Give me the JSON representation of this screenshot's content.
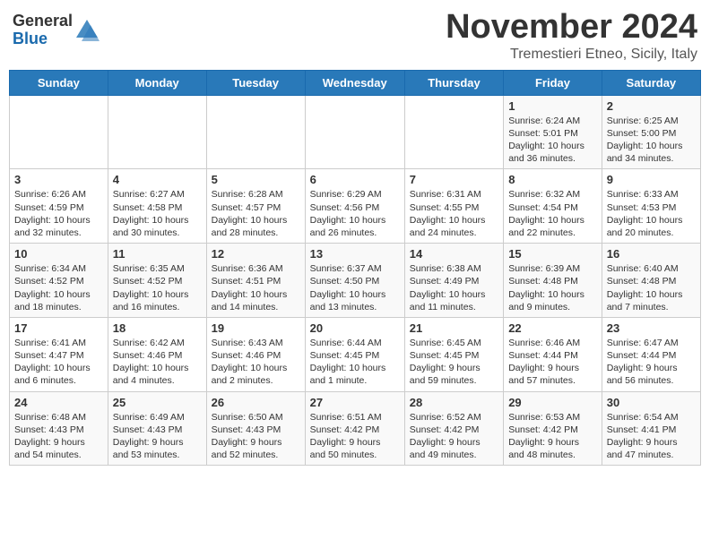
{
  "logo": {
    "general": "General",
    "blue": "Blue"
  },
  "title": "November 2024",
  "location": "Tremestieri Etneo, Sicily, Italy",
  "days_of_week": [
    "Sunday",
    "Monday",
    "Tuesday",
    "Wednesday",
    "Thursday",
    "Friday",
    "Saturday"
  ],
  "weeks": [
    [
      {
        "day": "",
        "content": ""
      },
      {
        "day": "",
        "content": ""
      },
      {
        "day": "",
        "content": ""
      },
      {
        "day": "",
        "content": ""
      },
      {
        "day": "",
        "content": ""
      },
      {
        "day": "1",
        "content": "Sunrise: 6:24 AM\nSunset: 5:01 PM\nDaylight: 10 hours\nand 36 minutes."
      },
      {
        "day": "2",
        "content": "Sunrise: 6:25 AM\nSunset: 5:00 PM\nDaylight: 10 hours\nand 34 minutes."
      }
    ],
    [
      {
        "day": "3",
        "content": "Sunrise: 6:26 AM\nSunset: 4:59 PM\nDaylight: 10 hours\nand 32 minutes."
      },
      {
        "day": "4",
        "content": "Sunrise: 6:27 AM\nSunset: 4:58 PM\nDaylight: 10 hours\nand 30 minutes."
      },
      {
        "day": "5",
        "content": "Sunrise: 6:28 AM\nSunset: 4:57 PM\nDaylight: 10 hours\nand 28 minutes."
      },
      {
        "day": "6",
        "content": "Sunrise: 6:29 AM\nSunset: 4:56 PM\nDaylight: 10 hours\nand 26 minutes."
      },
      {
        "day": "7",
        "content": "Sunrise: 6:31 AM\nSunset: 4:55 PM\nDaylight: 10 hours\nand 24 minutes."
      },
      {
        "day": "8",
        "content": "Sunrise: 6:32 AM\nSunset: 4:54 PM\nDaylight: 10 hours\nand 22 minutes."
      },
      {
        "day": "9",
        "content": "Sunrise: 6:33 AM\nSunset: 4:53 PM\nDaylight: 10 hours\nand 20 minutes."
      }
    ],
    [
      {
        "day": "10",
        "content": "Sunrise: 6:34 AM\nSunset: 4:52 PM\nDaylight: 10 hours\nand 18 minutes."
      },
      {
        "day": "11",
        "content": "Sunrise: 6:35 AM\nSunset: 4:52 PM\nDaylight: 10 hours\nand 16 minutes."
      },
      {
        "day": "12",
        "content": "Sunrise: 6:36 AM\nSunset: 4:51 PM\nDaylight: 10 hours\nand 14 minutes."
      },
      {
        "day": "13",
        "content": "Sunrise: 6:37 AM\nSunset: 4:50 PM\nDaylight: 10 hours\nand 13 minutes."
      },
      {
        "day": "14",
        "content": "Sunrise: 6:38 AM\nSunset: 4:49 PM\nDaylight: 10 hours\nand 11 minutes."
      },
      {
        "day": "15",
        "content": "Sunrise: 6:39 AM\nSunset: 4:48 PM\nDaylight: 10 hours\nand 9 minutes."
      },
      {
        "day": "16",
        "content": "Sunrise: 6:40 AM\nSunset: 4:48 PM\nDaylight: 10 hours\nand 7 minutes."
      }
    ],
    [
      {
        "day": "17",
        "content": "Sunrise: 6:41 AM\nSunset: 4:47 PM\nDaylight: 10 hours\nand 6 minutes."
      },
      {
        "day": "18",
        "content": "Sunrise: 6:42 AM\nSunset: 4:46 PM\nDaylight: 10 hours\nand 4 minutes."
      },
      {
        "day": "19",
        "content": "Sunrise: 6:43 AM\nSunset: 4:46 PM\nDaylight: 10 hours\nand 2 minutes."
      },
      {
        "day": "20",
        "content": "Sunrise: 6:44 AM\nSunset: 4:45 PM\nDaylight: 10 hours\nand 1 minute."
      },
      {
        "day": "21",
        "content": "Sunrise: 6:45 AM\nSunset: 4:45 PM\nDaylight: 9 hours\nand 59 minutes."
      },
      {
        "day": "22",
        "content": "Sunrise: 6:46 AM\nSunset: 4:44 PM\nDaylight: 9 hours\nand 57 minutes."
      },
      {
        "day": "23",
        "content": "Sunrise: 6:47 AM\nSunset: 4:44 PM\nDaylight: 9 hours\nand 56 minutes."
      }
    ],
    [
      {
        "day": "24",
        "content": "Sunrise: 6:48 AM\nSunset: 4:43 PM\nDaylight: 9 hours\nand 54 minutes."
      },
      {
        "day": "25",
        "content": "Sunrise: 6:49 AM\nSunset: 4:43 PM\nDaylight: 9 hours\nand 53 minutes."
      },
      {
        "day": "26",
        "content": "Sunrise: 6:50 AM\nSunset: 4:43 PM\nDaylight: 9 hours\nand 52 minutes."
      },
      {
        "day": "27",
        "content": "Sunrise: 6:51 AM\nSunset: 4:42 PM\nDaylight: 9 hours\nand 50 minutes."
      },
      {
        "day": "28",
        "content": "Sunrise: 6:52 AM\nSunset: 4:42 PM\nDaylight: 9 hours\nand 49 minutes."
      },
      {
        "day": "29",
        "content": "Sunrise: 6:53 AM\nSunset: 4:42 PM\nDaylight: 9 hours\nand 48 minutes."
      },
      {
        "day": "30",
        "content": "Sunrise: 6:54 AM\nSunset: 4:41 PM\nDaylight: 9 hours\nand 47 minutes."
      }
    ]
  ]
}
